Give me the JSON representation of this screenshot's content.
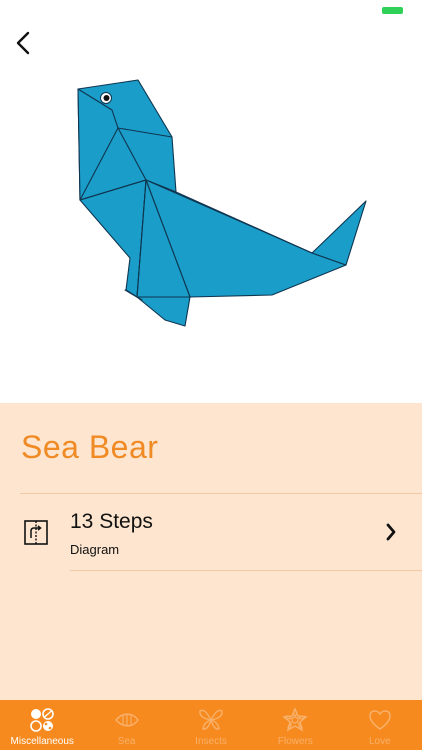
{
  "detail": {
    "title": "Sea Bear",
    "steps_label": "13 Steps",
    "steps_sub": "Diagram"
  },
  "tabs": [
    {
      "label": "Miscellaneous",
      "icon": "circles-icon",
      "active": true
    },
    {
      "label": "Sea",
      "icon": "fish-icon",
      "active": false
    },
    {
      "label": "Insects",
      "icon": "butterfly-icon",
      "active": false
    },
    {
      "label": "Flowers",
      "icon": "flower-icon",
      "active": false
    },
    {
      "label": "Love",
      "icon": "heart-icon",
      "active": false
    }
  ],
  "colors": {
    "accent": "#f68a1e",
    "title": "#f08a24",
    "panel": "#fde5cf",
    "origami": "#1a9dc8",
    "battery": "#2fd158"
  }
}
